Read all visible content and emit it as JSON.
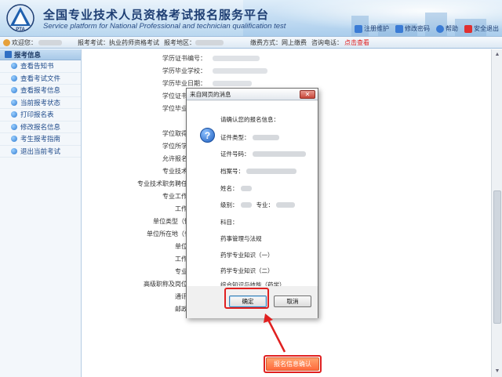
{
  "header": {
    "title": "全国专业技术人员资格考试报名服务平台",
    "subtitle": "Service platform for National Professional and technician qualification test",
    "logo_text": "PTA",
    "links": [
      {
        "label": "注册维护",
        "icon": "edit-icon",
        "color": "#3a7bd5"
      },
      {
        "label": "修改密码",
        "icon": "key-icon",
        "color": "#3a7bd5"
      },
      {
        "label": "帮助",
        "icon": "help-icon",
        "color": "#3a7bd5"
      },
      {
        "label": "安全退出",
        "icon": "exit-icon",
        "color": "#e03030"
      }
    ]
  },
  "infobar": {
    "welcome": "欢迎您：",
    "exam_label": "报考考试：",
    "exam_value": "执业药师资格考试",
    "region_label": "报考地区：",
    "fee_label": "缴费方式：",
    "fee_value": "网上缴费",
    "phone_label": "咨询电话：",
    "phone_link": "点击查看"
  },
  "sidebar": {
    "header": "报考信息",
    "items": [
      {
        "label": "查看告知书"
      },
      {
        "label": "查看考试文件"
      },
      {
        "label": "查看报考信息"
      },
      {
        "label": "当前报考状态"
      },
      {
        "label": "打印报名表"
      },
      {
        "label": "修改报名信息"
      },
      {
        "label": "考生报考指南"
      },
      {
        "label": "退出当前考试"
      }
    ]
  },
  "form": {
    "rows": [
      {
        "label": "学历证书编号："
      },
      {
        "label": "学历毕业学校："
      },
      {
        "label": "学历毕业日期："
      },
      {
        "label": "学位证书编号："
      },
      {
        "label": "学位毕业学校："
      },
      {
        "label": "学位取得日期："
      },
      {
        "label": "学位所学专业："
      },
      {
        "label": "允许报名学位："
      },
      {
        "label": "专业技术职称："
      },
      {
        "label": "专业技术职务聘任时间："
      },
      {
        "label": "专业工作年限："
      },
      {
        "label": "工作单位："
      },
      {
        "label": "单位类型（性质）："
      },
      {
        "label": "单位所在地（省市）："
      },
      {
        "label": "单位电话："
      },
      {
        "label": "工作年限："
      },
      {
        "label": "专业年限："
      },
      {
        "label": "高级职称及岗位情况："
      },
      {
        "label": "通讯地址："
      },
      {
        "label": "邮政编码："
      }
    ],
    "submit": "报名信息确认"
  },
  "dialog": {
    "title": "来自网页的消息",
    "close": "✕",
    "heading": "请确认您的报名信息：",
    "fields": [
      {
        "label": "证件类型："
      },
      {
        "label": "证件号码："
      },
      {
        "label": "档案号："
      },
      {
        "label": "姓名："
      },
      {
        "label": "级别：",
        "extra": "专业："
      },
      {
        "label": "科目："
      },
      {
        "label": "药事管理与法规"
      },
      {
        "label": "药学专业知识（一）"
      },
      {
        "label": "药学专业知识（二）"
      },
      {
        "label": "综合知识与技能（药学）"
      }
    ],
    "ok": "确定",
    "cancel": "取消"
  },
  "colors": {
    "highlight": "#e02020",
    "submit": "#ff6a3d",
    "header_text": "#1e3e73"
  }
}
